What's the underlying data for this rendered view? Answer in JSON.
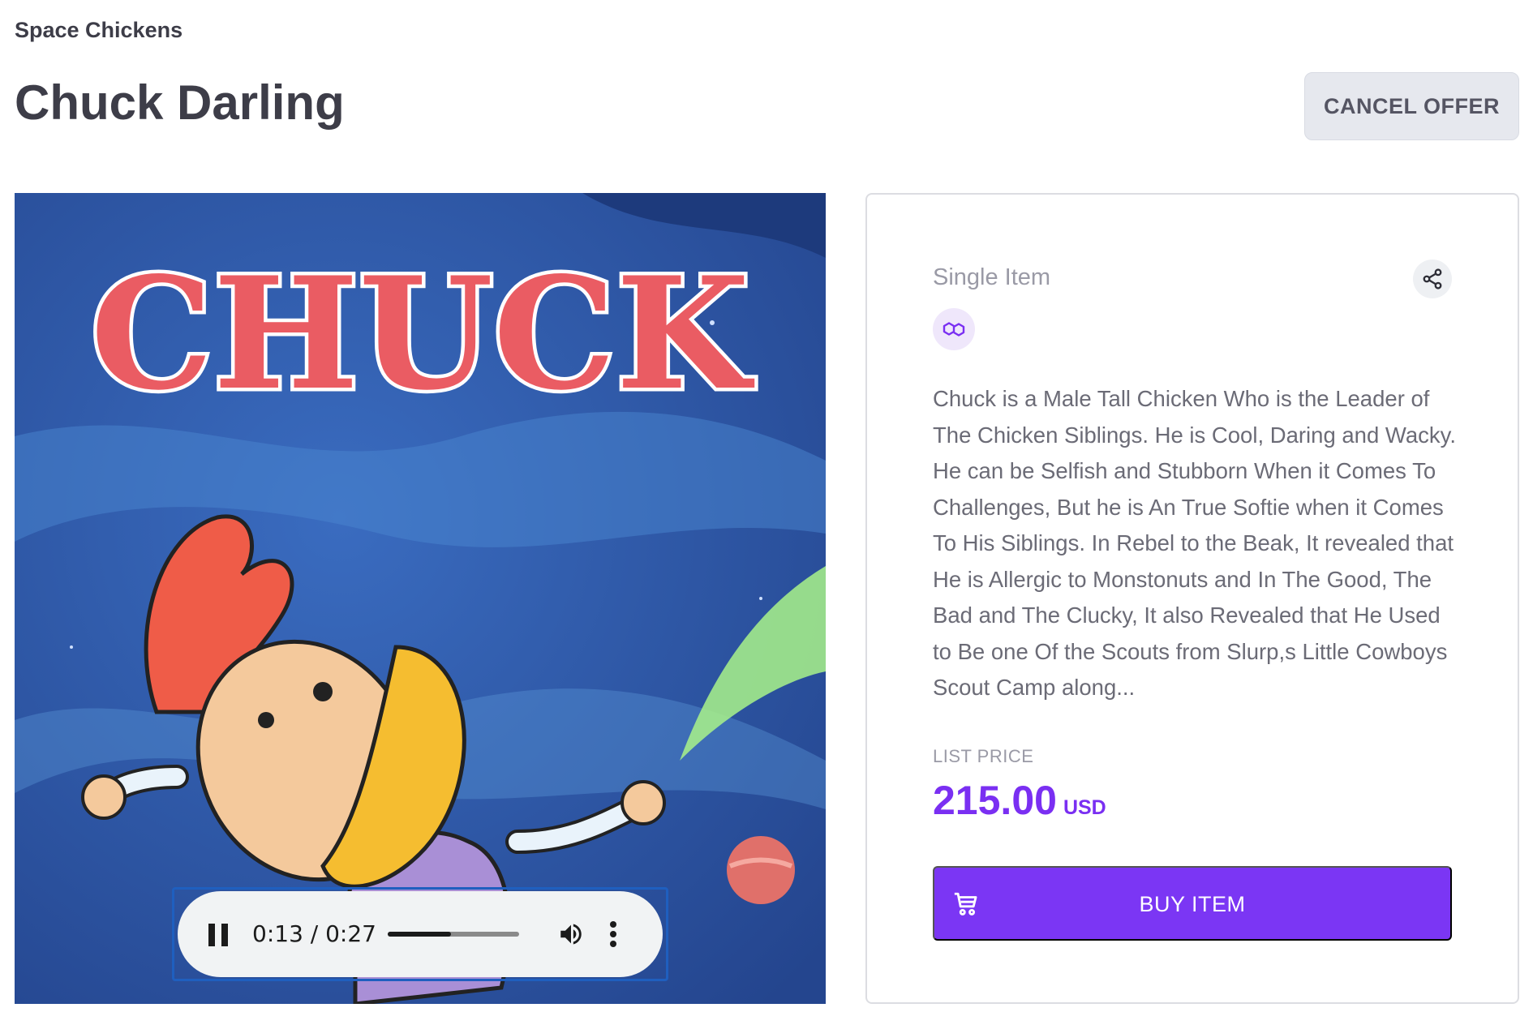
{
  "header": {
    "collection": "Space Chickens",
    "title": "Chuck Darling",
    "cancel_label": "CANCEL OFFER"
  },
  "media": {
    "art_text": "CHUCK",
    "audio": {
      "time": "0:13 / 0:27",
      "progress_fraction": 0.48
    }
  },
  "panel": {
    "kind": "Single Item",
    "description": "Chuck is a Male Tall Chicken Who is the Leader of The Chicken Siblings. He is Cool, Daring and Wacky. He can be Selfish and Stubborn When it Comes To Challenges, But he is An True Softie when it Comes To His Siblings. In Rebel to the Beak, It revealed that He is Allergic to Monstonuts and In The Good, The Bad and The Clucky, It also Revealed that He Used to Be one Of the Scouts from Slurp,s Little Cowboys Scout Camp along...",
    "list_price_label": "LIST PRICE",
    "price": "215.00",
    "currency": "USD",
    "buy_label": "BUY ITEM"
  },
  "icons": {
    "share": "share-icon",
    "chain": "polygon-icon",
    "cart": "cart-icon",
    "pause": "pause-icon",
    "volume": "volume-icon",
    "more": "more-vertical-icon"
  },
  "colors": {
    "accent": "#7b36f4",
    "price": "#7a2ff2",
    "chain_bg": "#efe7fb",
    "cancel_bg": "#e6e8ee"
  }
}
